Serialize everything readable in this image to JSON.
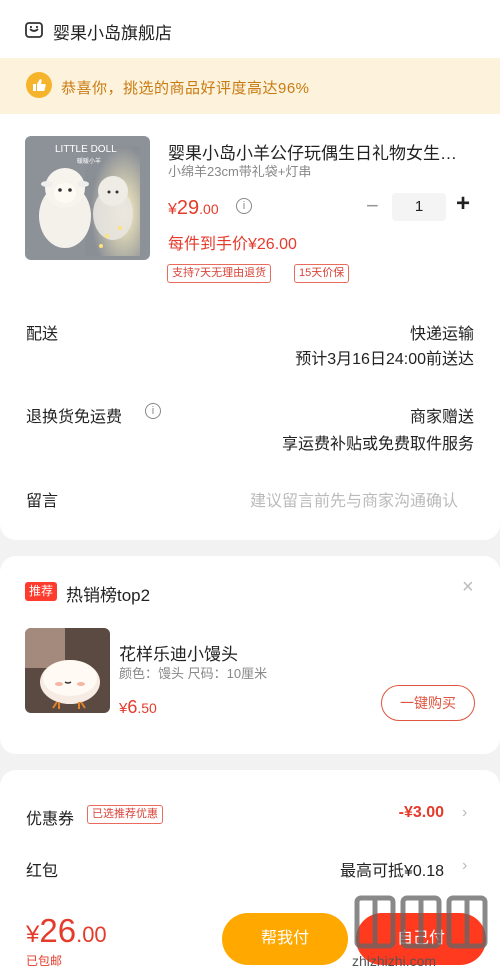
{
  "store": {
    "name": "婴果小岛旗舰店",
    "icon": "store-icon"
  },
  "banner": {
    "text": "恭喜你，挑选的商品好评度高达96%",
    "icon": "thumbs-up-icon"
  },
  "product": {
    "title": "婴果小岛小羊公仔玩偶生日礼物女生…",
    "spec": "小绵羊23cm带礼袋+灯串",
    "price_currency": "¥",
    "price_int": "29",
    "price_dec": ".00",
    "quantity": "1",
    "minus": "−",
    "plus": "+",
    "each_price": "每件到手价¥26.00",
    "tags": [
      "支持7天无理由退货",
      "15天价保"
    ],
    "image_text_1": "LITTLE DOLL",
    "image_text_2": "暖暖小羊"
  },
  "delivery": {
    "label": "配送",
    "method": "快递运输",
    "eta": "预计3月16日24:00前送达"
  },
  "returns": {
    "label": "退换货免运费",
    "value": "商家赠送",
    "desc": "享运费补贴或免费取件服务"
  },
  "message": {
    "label": "留言",
    "placeholder": "建议留言前先与商家沟通确认"
  },
  "recommend": {
    "badge": "推荐",
    "title": "热销榜top2",
    "close": "×",
    "item_name": "花样乐迪小馒头",
    "item_spec": "颜色：馒头   尺码：10厘米",
    "price_currency": "¥",
    "price_int": "6",
    "price_dec": ".50",
    "buy_label": "一键购买"
  },
  "coupon": {
    "label": "优惠券",
    "tag": "已选推荐优惠",
    "value": "-¥3.00"
  },
  "redpack": {
    "label": "红包",
    "value": "最高可抵¥0.18"
  },
  "footer": {
    "total_currency": "¥",
    "total_int": "26",
    "total_dec": ".00",
    "shipping": "已包邮",
    "help_pay": "帮我付",
    "self_pay": "自己付",
    "watermark": "zhizhizhi.com"
  },
  "colors": {
    "accent": "#e43b2b",
    "orange": "#ffa800",
    "red_button": "#ff3a1f",
    "banner_bg": "#fdf3dc"
  }
}
